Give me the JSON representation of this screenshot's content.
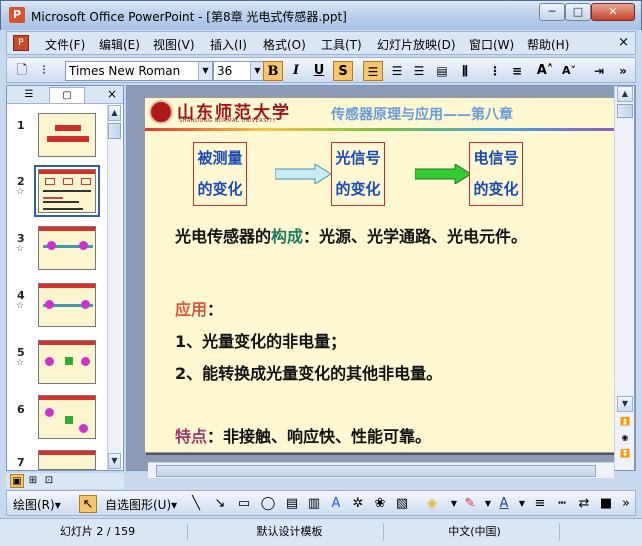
{
  "window": {
    "title": "Microsoft Office PowerPoint - [第8章  光电式传感器.ppt]",
    "minimize": "─",
    "maximize": "□",
    "close": "✕"
  },
  "menu": {
    "items": [
      "文件(F)",
      "编辑(E)",
      "视图(V)",
      "插入(I)",
      "格式(O)",
      "工具(T)",
      "幻灯片放映(D)",
      "窗口(W)",
      "帮助(H)"
    ],
    "close": "×"
  },
  "toolbar": {
    "font": "Times New Roman",
    "size": "36",
    "bold": "B",
    "italic": "I",
    "underline": "U",
    "shadow": "S",
    "grow_font": "A˄",
    "shrink_font": "A˅"
  },
  "slides_pane": {
    "thumbnails": [
      {
        "num": "1",
        "star": ""
      },
      {
        "num": "2",
        "star": "☆"
      },
      {
        "num": "3",
        "star": "☆"
      },
      {
        "num": "4",
        "star": "☆"
      },
      {
        "num": "5",
        "star": "☆"
      },
      {
        "num": "6",
        "star": ""
      },
      {
        "num": "7",
        "star": ""
      }
    ],
    "close": "×"
  },
  "slide": {
    "school_name": "山东师范大学",
    "school_en": "SHANDONG NORMAL UNIVERSITY",
    "chapter": "传感器原理与应用——第八章",
    "flow": [
      {
        "line1": "被测量",
        "line2": "的变化"
      },
      {
        "line1": "光信号",
        "line2": "的变化"
      },
      {
        "line1": "电信号",
        "line2": "的变化"
      }
    ],
    "composition_prefix": "光电传感器的",
    "composition_key": "构成",
    "composition_rest": "：光源、光学通路、光电元件。",
    "application_key": "应用",
    "application_colon": "：",
    "application_1": "1、光量变化的非电量；",
    "application_2": "2、能转换成光量变化的其他非电量。",
    "feature_key": "特点",
    "feature_rest": "：非接触、响应快、性能可靠。",
    "colors": {
      "box_border": "#d12b2b",
      "box_text": "#1a4ab5",
      "arrow1": "#c7ecf3",
      "arrow2": "#33cc33",
      "key_green": "#1e7b5c",
      "key_red": "#d65a3a",
      "key_purple": "#9d3b6e"
    }
  },
  "drawing_toolbar": {
    "draw": "绘图(R)▾",
    "autoshapes": "自选图形(U)▾"
  },
  "status": {
    "slide_info": "幻灯片 2 / 159",
    "design": "默认设计模板",
    "language": "中文(中国)"
  }
}
